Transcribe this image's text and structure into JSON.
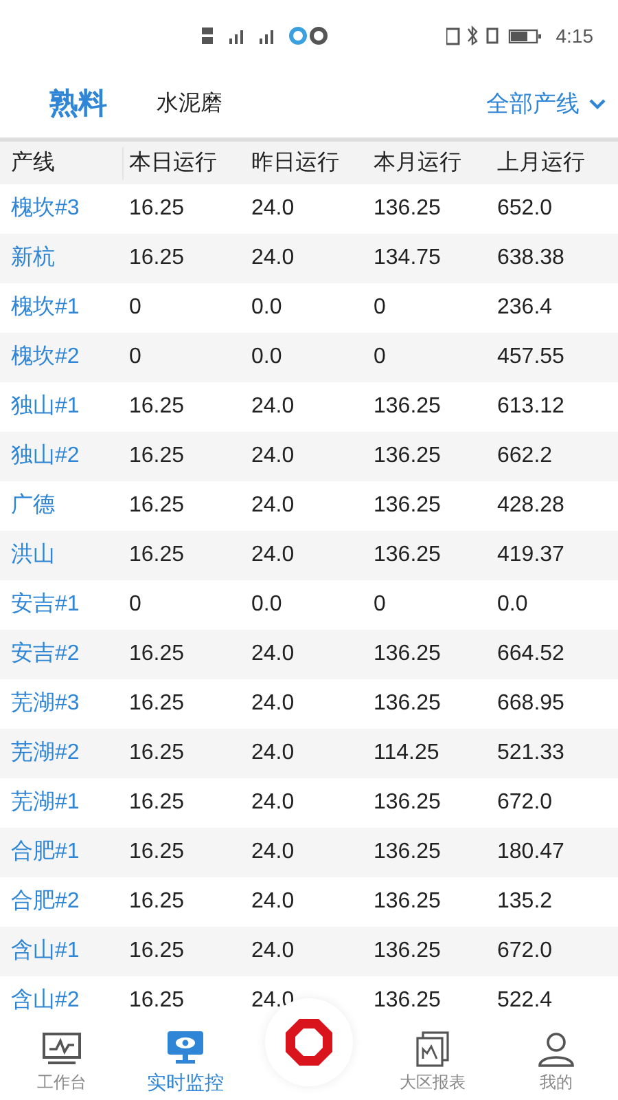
{
  "status_bar": {
    "time": "4:15"
  },
  "tabs": [
    {
      "label": "熟料",
      "selected": true
    },
    {
      "label": "水泥磨",
      "selected": false
    }
  ],
  "line_filter": {
    "label": "全部产线"
  },
  "table": {
    "columns": [
      "产线",
      "本日运行",
      "昨日运行",
      "本月运行",
      "上月运行"
    ],
    "rows": [
      [
        "槐坎#3",
        "16.25",
        "24.0",
        "136.25",
        "652.0"
      ],
      [
        "新杭",
        "16.25",
        "24.0",
        "134.75",
        "638.38"
      ],
      [
        "槐坎#1",
        "0",
        "0.0",
        "0",
        "236.4"
      ],
      [
        "槐坎#2",
        "0",
        "0.0",
        "0",
        "457.55"
      ],
      [
        "独山#1",
        "16.25",
        "24.0",
        "136.25",
        "613.12"
      ],
      [
        "独山#2",
        "16.25",
        "24.0",
        "136.25",
        "662.2"
      ],
      [
        "广德",
        "16.25",
        "24.0",
        "136.25",
        "428.28"
      ],
      [
        "洪山",
        "16.25",
        "24.0",
        "136.25",
        "419.37"
      ],
      [
        "安吉#1",
        "0",
        "0.0",
        "0",
        "0.0"
      ],
      [
        "安吉#2",
        "16.25",
        "24.0",
        "136.25",
        "664.52"
      ],
      [
        "芜湖#3",
        "16.25",
        "24.0",
        "136.25",
        "668.95"
      ],
      [
        "芜湖#2",
        "16.25",
        "24.0",
        "114.25",
        "521.33"
      ],
      [
        "芜湖#1",
        "16.25",
        "24.0",
        "136.25",
        "672.0"
      ],
      [
        "合肥#1",
        "16.25",
        "24.0",
        "136.25",
        "180.47"
      ],
      [
        "合肥#2",
        "16.25",
        "24.0",
        "136.25",
        "135.2"
      ],
      [
        "含山#1",
        "16.25",
        "24.0",
        "136.25",
        "672.0"
      ],
      [
        "含山#2",
        "16.25",
        "24.0",
        "136.25",
        "522.4"
      ]
    ]
  },
  "bottom_nav": [
    {
      "kind": "workbench",
      "label": "工作台",
      "selected": false
    },
    {
      "kind": "monitor",
      "label": "实时监控",
      "selected": true
    },
    {
      "kind": "center"
    },
    {
      "kind": "report",
      "label": "大区报表",
      "selected": false
    },
    {
      "kind": "profile",
      "label": "我的",
      "selected": false
    }
  ]
}
